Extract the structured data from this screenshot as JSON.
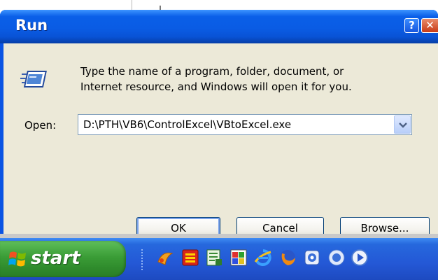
{
  "window": {
    "title": "Run",
    "help_glyph": "?",
    "close_glyph": "✕"
  },
  "dialog": {
    "description_line1": "Type the name of a program, folder, document, or",
    "description_line2": "Internet resource, and Windows will open it for you.",
    "open_label": "Open:",
    "open_value": "D:\\PTH\\VB6\\ControlExcel\\VBtoExcel.exe",
    "icon": "run-icon",
    "dropdown_icon": "chevron-down-icon"
  },
  "buttons": {
    "ok": "OK",
    "cancel": "Cancel",
    "browse": "Browse..."
  },
  "taskbar": {
    "start_label": "start",
    "quick_launch_icons": [
      "app-icon",
      "media-icon",
      "document-icon",
      "paint-icon",
      "internet-explorer-icon",
      "firefox-icon",
      "settings-icon",
      "media-player-icon",
      "play-icon"
    ]
  },
  "colors": {
    "titlebar": "#0a5ce4",
    "client": "#ece9d8",
    "start_button": "#3a9c36",
    "taskbar": "#2458d6"
  }
}
